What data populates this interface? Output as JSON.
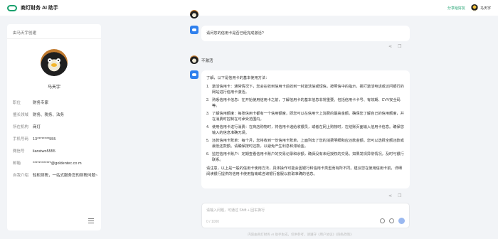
{
  "header": {
    "app_title": "商灯财务 AI 助手",
    "share_label": "分享给好友",
    "user_name": "马天宇"
  },
  "sidebar": {
    "created_by": "由马天宇创建",
    "profile_name": "马天宇",
    "details": [
      {
        "label": "职位",
        "value": "财务专家"
      },
      {
        "label": "擅长领域",
        "value": "财务、税务、法务"
      },
      {
        "label": "所在机构",
        "value": "商灯"
      },
      {
        "label": "手机号码",
        "value": "13********555"
      },
      {
        "label": "微信号",
        "value": "lianxiwo5555"
      },
      {
        "label": "邮箱",
        "value": "************@goldentec.co m"
      },
      {
        "label": "自我介绍",
        "value": "轻松财税，一站式服务您的财税问题~"
      }
    ]
  },
  "chat": {
    "q1": "请问您的信用卡是否已经完成激活?",
    "user_reply": "不激活",
    "answer_intro": "了解，以下是信用卡的基本使用方法：",
    "answer_items": [
      "激活信用卡：通常情况下，您会在收到信用卡后收到一封激活信或短信。按照信中的指示，拨打激活电话或访问银行的网站进行信用卡激活。",
      "熟悉信用卡信息：在开始使用信用卡之前，了解信用卡的基本信息非常重要。包括信用卡卡号、有效期、CVV安全码等。",
      "了解信用额度：每张信用卡都有一个信用额度，即您可以在信用卡上消费的最高金额。确保您了解自己的信用额度，并在消费时控制在可承受范围内。",
      "使用信用卡进行消费：在商店购物时，将信用卡递给收银员，或者在网上购物时，在结账页面输入信用卡信息。确保您输入的信息准确无误。",
      "还款信用卡账单：每个月，您将收到一份信用卡账单，上面列出了您的消费明细和应还款金额。您可以选择全额还款或最低还款额。请确保按时还款，以避免产生利息和滞纳金。",
      "监控信用卡账户：定期查看信用卡账户的交易记录和余额，确保没有未经授权的交易。如果发现异常情况，及时与银行联系。"
    ],
    "answer_outro": "请注意，以上是一般的信用卡使用方法，具体操作可能会因银行和信用卡类型而有所不同。建议您在使用信用卡前，详细阅读银行提供的信用卡使用指南或咨询银行客服以获取准确的信息。"
  },
  "input": {
    "placeholder": "请输入问题，可通过 Shift + 回车换行",
    "char_count": "0 / 1000"
  },
  "footer": {
    "text": "内容由商灯财务 AI 助手生成，仅供参考，请遵守《用户协议》《隐私政策》"
  },
  "colors": {
    "brand": "#1aa06d",
    "bot_avatar": "#2f80ed",
    "page_bg": "#f2f4f7"
  }
}
